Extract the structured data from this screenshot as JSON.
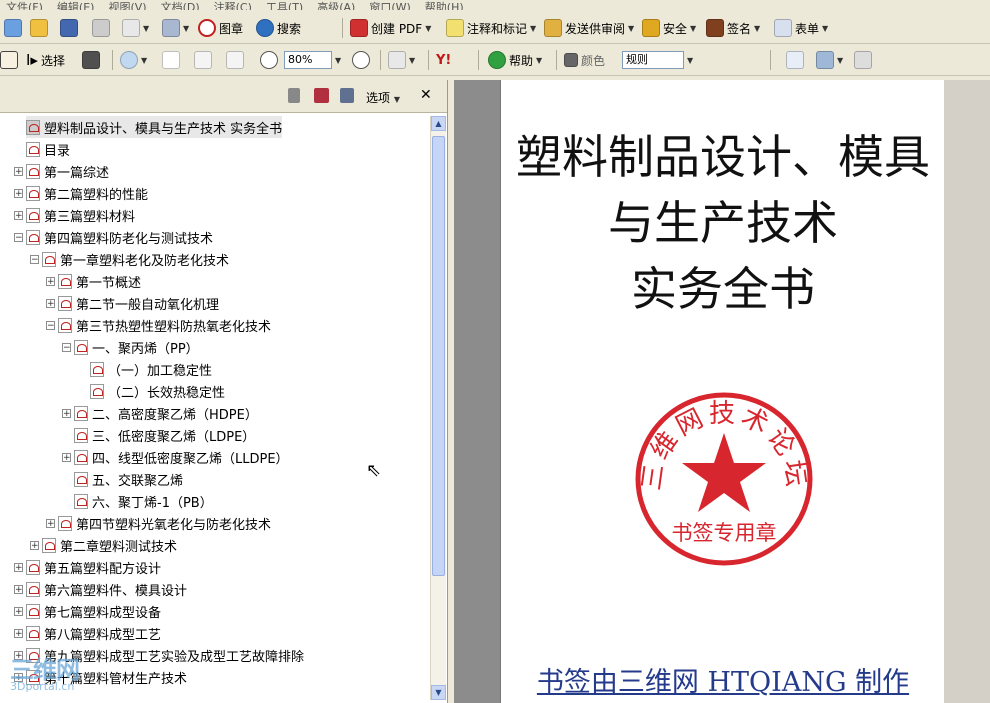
{
  "menu": [
    "文件(F)",
    "编辑(E)",
    "视图(V)",
    "文档(D)",
    "注释(C)",
    "工具(T)",
    "高级(A)",
    "窗口(W)",
    "帮助(H)"
  ],
  "toolbar1": {
    "stamp_label": "图章",
    "search_label": "搜索",
    "create_pdf_label": "创建 PDF",
    "comment_label": "注释和标记",
    "review_label": "发送供审阅",
    "security_label": "安全",
    "sign_label": "签名",
    "forms_label": "表单"
  },
  "toolbar2": {
    "select_label": "选择",
    "zoom_value": "80%",
    "help_label": "帮助",
    "color_label": "颜色",
    "rule_value": "规则"
  },
  "bookmarks_panel": {
    "options_label": "选项",
    "items": [
      "塑料制品设计、模具与生产技术 实务全书",
      "目录",
      "第一篇综述",
      "第二篇塑料的性能",
      "第三篇塑料材料",
      "第四篇塑料防老化与测试技术",
      "第一章塑料老化及防老化技术",
      "第一节概述",
      "第二节一般自动氧化机理",
      "第三节热塑性塑料防热氧老化技术",
      "一、聚丙烯（PP）",
      "（一）加工稳定性",
      "（二）长效热稳定性",
      "二、高密度聚乙烯（HDPE）",
      "三、低密度聚乙烯（LDPE）",
      "四、线型低密度聚乙烯（LLDPE）",
      "五、交联聚乙烯",
      "六、聚丁烯-1（PB）",
      "第四节塑料光氧老化与防老化技术",
      "第二章塑料测试技术",
      "第五篇塑料配方设计",
      "第六篇塑料件、模具设计",
      "第七篇塑料成型设备",
      "第八篇塑料成型工艺",
      "第九篇塑料成型工艺实验及成型工艺故障排除",
      "第十篇塑料管材生产技术"
    ]
  },
  "document": {
    "title_lines": [
      "塑料制品设计、模具",
      "与生产技术",
      "实务全书"
    ],
    "seal_top_text": "三维网技术论坛",
    "seal_bottom_text": "书签专用章",
    "footer": "书签由三维网 HTQIANG 制作",
    "seal_color": "#d8262e"
  },
  "watermark": {
    "line1": "三维网",
    "line2": "3Dportal.cn"
  }
}
